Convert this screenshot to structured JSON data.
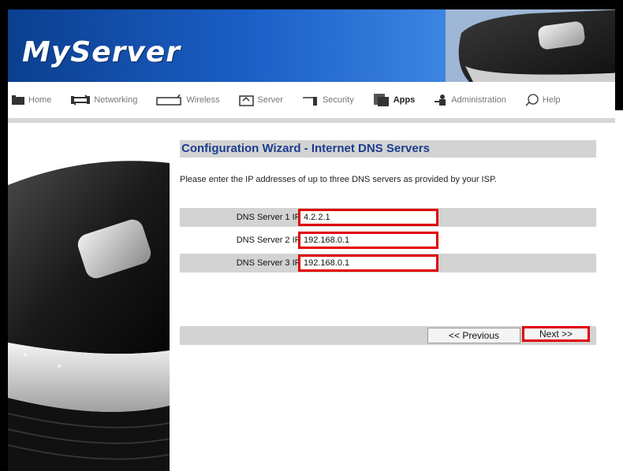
{
  "brand": {
    "logo_text": "MyServer"
  },
  "nav": {
    "items": [
      {
        "label": "Home",
        "icon": "home-icon",
        "bold": false
      },
      {
        "label": "Networking",
        "icon": "networking-icon",
        "bold": false
      },
      {
        "label": "Wireless",
        "icon": "wireless-icon",
        "bold": false
      },
      {
        "label": "Server",
        "icon": "server-icon",
        "bold": false
      },
      {
        "label": "Security",
        "icon": "security-icon",
        "bold": false
      },
      {
        "label": "Apps",
        "icon": "apps-icon",
        "bold": true
      },
      {
        "label": "Administration",
        "icon": "administration-icon",
        "bold": false
      },
      {
        "label": "Help",
        "icon": "help-icon",
        "bold": false
      }
    ]
  },
  "wizard": {
    "title": "Configuration Wizard - Internet DNS Servers",
    "instructions": "Please enter the IP addresses of up to three DNS servers as provided by your ISP.",
    "dns": [
      {
        "label": "DNS Server 1 IP",
        "value": "4.2.2.1"
      },
      {
        "label": "DNS Server 2 IP",
        "value": "192.168.0.1"
      },
      {
        "label": "DNS Server 3 IP",
        "value": "192.168.0.1"
      }
    ],
    "previous_label": "<< Previous",
    "next_label": "Next >>"
  },
  "colors": {
    "header_blue": "#1b5fc7",
    "title_blue": "#1b3d8f",
    "highlight_red": "#e00000",
    "row_gray": "#d3d3d3"
  }
}
